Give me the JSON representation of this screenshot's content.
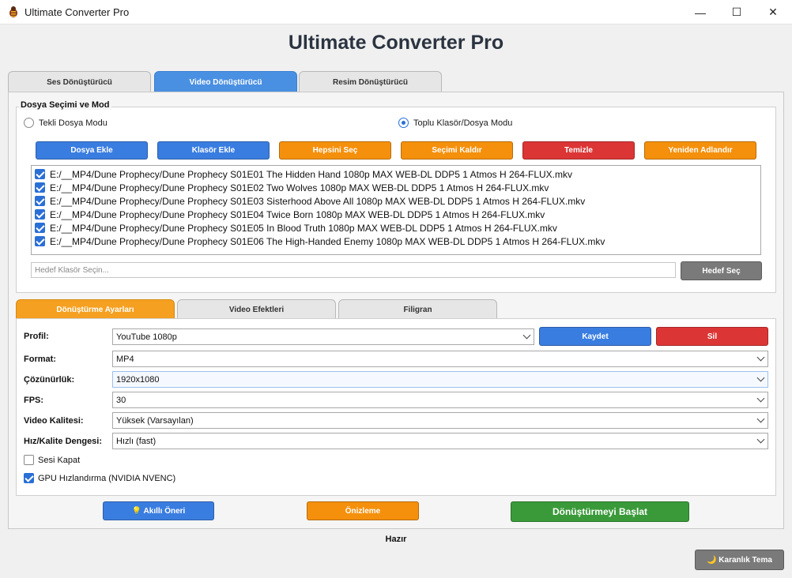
{
  "window": {
    "title": "Ultimate Converter Pro",
    "min_glyph": "—",
    "max_glyph": "☐",
    "close_glyph": "✕"
  },
  "app": {
    "heading": "Ultimate Converter Pro"
  },
  "main_tabs": [
    {
      "label": "Ses Dönüştürücü",
      "active": false
    },
    {
      "label": "Video Dönüştürücü",
      "active": true
    },
    {
      "label": "Resim Dönüştürücü",
      "active": false
    }
  ],
  "file_section": {
    "title": "Dosya Seçimi ve Mod",
    "mode_single": "Tekli Dosya Modu",
    "mode_batch": "Toplu Klasör/Dosya Modu",
    "selected_mode": "batch",
    "buttons": {
      "add_file": "Dosya Ekle",
      "add_folder": "Klasör Ekle",
      "select_all": "Hepsini Seç",
      "deselect": "Seçimi Kaldır",
      "clear": "Temizle",
      "rename": "Yeniden Adlandır"
    },
    "files": [
      {
        "path": "E:/__MP4/Dune Prophecy/Dune Prophecy S01E01 The Hidden Hand 1080p MAX WEB-DL DDP5 1 Atmos H 264-FLUX.mkv",
        "checked": true
      },
      {
        "path": "E:/__MP4/Dune Prophecy/Dune Prophecy S01E02 Two Wolves 1080p MAX WEB-DL DDP5 1 Atmos H 264-FLUX.mkv",
        "checked": true
      },
      {
        "path": "E:/__MP4/Dune Prophecy/Dune Prophecy S01E03 Sisterhood Above All 1080p MAX WEB-DL DDP5 1 Atmos H 264-FLUX.mkv",
        "checked": true
      },
      {
        "path": "E:/__MP4/Dune Prophecy/Dune Prophecy S01E04 Twice Born 1080p MAX WEB-DL DDP5 1 Atmos H 264-FLUX.mkv",
        "checked": true
      },
      {
        "path": "E:/__MP4/Dune Prophecy/Dune Prophecy S01E05 In Blood Truth 1080p MAX WEB-DL DDP5 1 Atmos H 264-FLUX.mkv",
        "checked": true
      },
      {
        "path": "E:/__MP4/Dune Prophecy/Dune Prophecy S01E06 The High-Handed Enemy 1080p MAX WEB-DL DDP5 1 Atmos H 264-FLUX.mkv",
        "checked": true
      }
    ],
    "target_placeholder": "Hedef Klasör Seçin...",
    "target_value": "",
    "target_button": "Hedef Seç"
  },
  "sub_tabs": [
    {
      "label": "Dönüştürme Ayarları",
      "active": true
    },
    {
      "label": "Video Efektleri",
      "active": false
    },
    {
      "label": "Filigran",
      "active": false
    }
  ],
  "settings": {
    "profile_label": "Profil:",
    "profile_value": "YouTube 1080p",
    "save_button": "Kaydet",
    "delete_button": "Sil",
    "format_label": "Format:",
    "format_value": "MP4",
    "resolution_label": "Çözünürlük:",
    "resolution_value": "1920x1080",
    "fps_label": "FPS:",
    "fps_value": "30",
    "quality_label": "Video Kalitesi:",
    "quality_value": "Yüksek (Varsayılan)",
    "speed_label": "Hız/Kalite Dengesi:",
    "speed_value": "Hızlı (fast)",
    "mute_label": "Sesi Kapat",
    "mute_checked": false,
    "gpu_label": "GPU Hızlandırma (NVIDIA NVENC)",
    "gpu_checked": true
  },
  "actions": {
    "smart_suggest": "💡 Akıllı Öneri",
    "preview": "Önizleme",
    "start": "Dönüştürmeyi Başlat"
  },
  "status": {
    "text": "Hazır"
  },
  "theme_button": "🌙 Karanlık Tema",
  "colors": {
    "blue": "#3a7de0",
    "orange": "#f5900c",
    "red": "#dc3535",
    "green": "#3a9a3a",
    "gray": "#7a7a7a",
    "active_tab_blue": "#4a90e2",
    "active_tab_orange": "#f5a020"
  },
  "icons": {
    "app": "bug-app-icon",
    "smart": "lightbulb-icon",
    "theme": "moon-icon"
  }
}
